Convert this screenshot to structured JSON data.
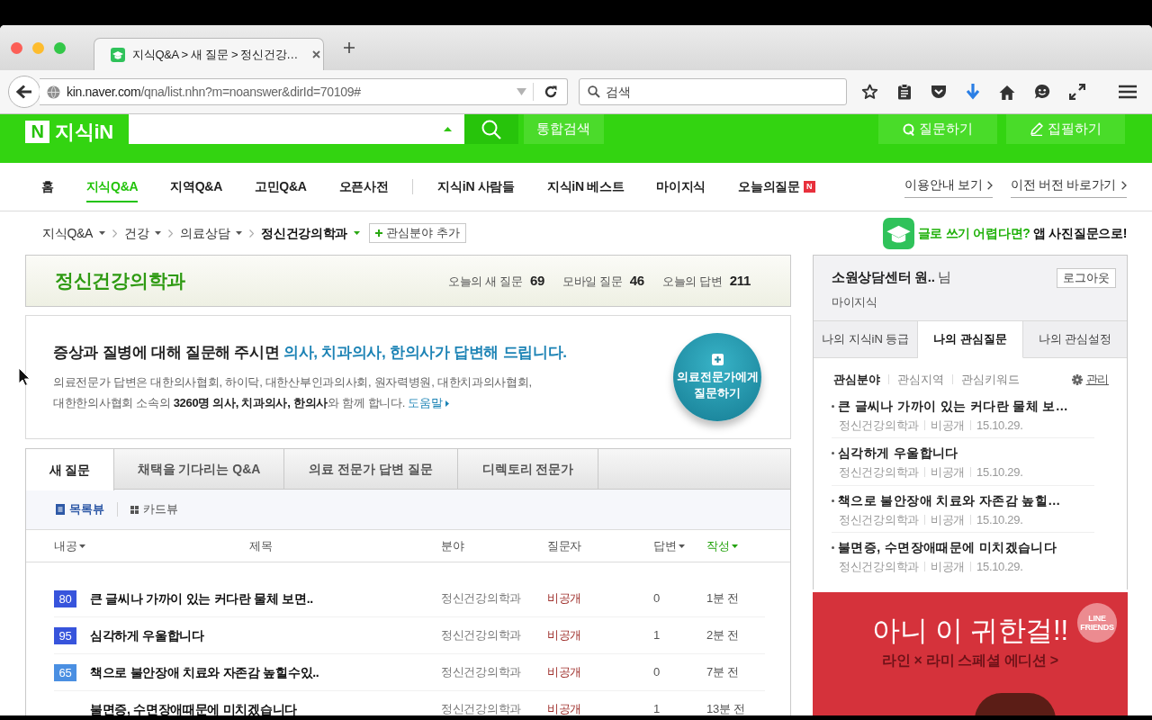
{
  "browser": {
    "tab": {
      "title": "지식Q&A > 새 질문 > 정신건강…"
    },
    "address": {
      "host": "kin.naver.com",
      "path": "/qna/list.nhn?m=noanswer&dirId=70109#"
    },
    "search": {
      "placeholder": "검색"
    }
  },
  "header": {
    "logo": {
      "badge": "N",
      "text": "지식iN"
    },
    "search": {
      "button": "통합검색"
    },
    "actions": [
      {
        "kind": "ask",
        "label": "질문하기"
      },
      {
        "kind": "write",
        "label": "집필하기"
      }
    ]
  },
  "nav": {
    "primary": [
      {
        "label": "홈",
        "selected": false
      },
      {
        "label": "지식Q&A",
        "selected": true
      },
      {
        "label": "지역Q&A",
        "selected": false
      },
      {
        "label": "고민Q&A",
        "selected": false
      },
      {
        "label": "오픈사전",
        "selected": false
      }
    ],
    "secondary": [
      {
        "label": "지식iN 사람들",
        "selected": false
      },
      {
        "label": "지식iN 베스트",
        "selected": false
      },
      {
        "label": "마이지식",
        "selected": false
      },
      {
        "label": "오늘의질문",
        "selected": false,
        "badge": "N"
      }
    ],
    "links": [
      {
        "label": "이용안내 보기"
      },
      {
        "label": "이전 버전 바로가기"
      }
    ]
  },
  "breadcrumb": {
    "items": [
      {
        "label": "지식Q&A",
        "current": false
      },
      {
        "label": "건강",
        "current": false
      },
      {
        "label": "의료상담",
        "current": false
      },
      {
        "label": "정신건강의학과",
        "current": true
      }
    ],
    "add_button": "관심분야 추가"
  },
  "promo": {
    "lead": "글로 쓰기 어렵다면?",
    "text": "앱 사진질문으로!"
  },
  "category": {
    "title": "정신건강의학과",
    "stats": [
      {
        "label": "오늘의 새 질문",
        "value": "69"
      },
      {
        "label": "모바일 질문",
        "value": "46"
      },
      {
        "label": "오늘의 답변",
        "value": "211"
      }
    ]
  },
  "intro": {
    "headline": "증상과 질병에 대해 질문해 주시면",
    "highlight": "의사, 치과의사, 한의사가 답변해 드립니다.",
    "description": "의료전문가 답변은 대한의사협회, 하이닥, 대한산부인과의사회, 원자력병원, 대한치과의사협회, 대한한의사협회 소속의 **3260명 의사, 치과의사, 한의사**와 함께 합니다.",
    "help_link": "도움말",
    "ask_button": "의료전문가에게 질문하기"
  },
  "list_tabs": [
    {
      "label": "새 질문",
      "selected": true
    },
    {
      "label": "채택을 기다리는 Q&A",
      "selected": false
    },
    {
      "label": "의료 전문가 답변 질문",
      "selected": false
    },
    {
      "label": "디렉토리 전문가",
      "selected": false
    }
  ],
  "views": [
    {
      "kind": "list",
      "label": "목록뷰",
      "selected": true
    },
    {
      "kind": "card",
      "label": "카드뷰",
      "selected": false
    }
  ],
  "table": {
    "columns": [
      {
        "label": "내공",
        "sortable": true,
        "sorted": false
      },
      {
        "label": "제목",
        "sortable": false,
        "sorted": false
      },
      {
        "label": "분야",
        "sortable": false,
        "sorted": false
      },
      {
        "label": "질문자",
        "sortable": false,
        "sorted": false
      },
      {
        "label": "답변",
        "sortable": true,
        "sorted": false
      },
      {
        "label": "작성",
        "sortable": true,
        "sorted": true
      }
    ],
    "rows": [
      {
        "points": "80",
        "color": "#3754dc",
        "title": "큰 글씨나 가까이 있는 커다란 물체 보면..",
        "category": "정신건강의학과",
        "asker": "비공개",
        "answers": "0",
        "time": "1분 전"
      },
      {
        "points": "95",
        "color": "#3754dc",
        "title": "심각하게 우울합니다",
        "category": "정신건강의학과",
        "asker": "비공개",
        "answers": "1",
        "time": "2분 전"
      },
      {
        "points": "65",
        "color": "#4a8fe2",
        "title": "책으로 불안장애 치료와 자존감 높힐수있..",
        "category": "정신건강의학과",
        "asker": "비공개",
        "answers": "0",
        "time": "7분 전"
      },
      {
        "title": "불면증, 수면장애때문에 미치겠습니다",
        "category": "정신건강의학과",
        "asker": "비공개",
        "answers": "1",
        "time": "13분 전"
      }
    ]
  },
  "sidebar": {
    "user": {
      "name": "소원상담센터 원..",
      "suffix": "님",
      "logout": "로그아웃",
      "link": "마이지식"
    },
    "tabs": [
      {
        "label": "나의 지식iN 등급",
        "selected": false
      },
      {
        "label": "나의 관심질문",
        "selected": true
      },
      {
        "label": "나의 관심설정",
        "selected": false
      }
    ],
    "filters": [
      {
        "label": "관심분야",
        "selected": true
      },
      {
        "label": "관심지역",
        "selected": false
      },
      {
        "label": "관심키워드",
        "selected": false
      }
    ],
    "manage": "관리",
    "questions": [
      {
        "title": "큰 글씨나 가까이 있는 커다란 물체 보…",
        "category": "정신건강의학과",
        "asker": "비공개",
        "date": "15.10.29."
      },
      {
        "title": "심각하게 우울합니다",
        "category": "정신건강의학과",
        "asker": "비공개",
        "date": "15.10.29."
      },
      {
        "title": "책으로 불안장애 치료와 자존감 높힐…",
        "category": "정신건강의학과",
        "asker": "비공개",
        "date": "15.10.29."
      },
      {
        "title": "불면증, 수면장애때문에 미치겠습니다",
        "category": "정신건강의학과",
        "asker": "비공개",
        "date": "15.10.29."
      }
    ]
  },
  "ad": {
    "headline": "아니 이 귀한걸!!",
    "subline": "라인 × 라미 스페셜 에디션 >",
    "brand": "LINE FRIENDS"
  }
}
